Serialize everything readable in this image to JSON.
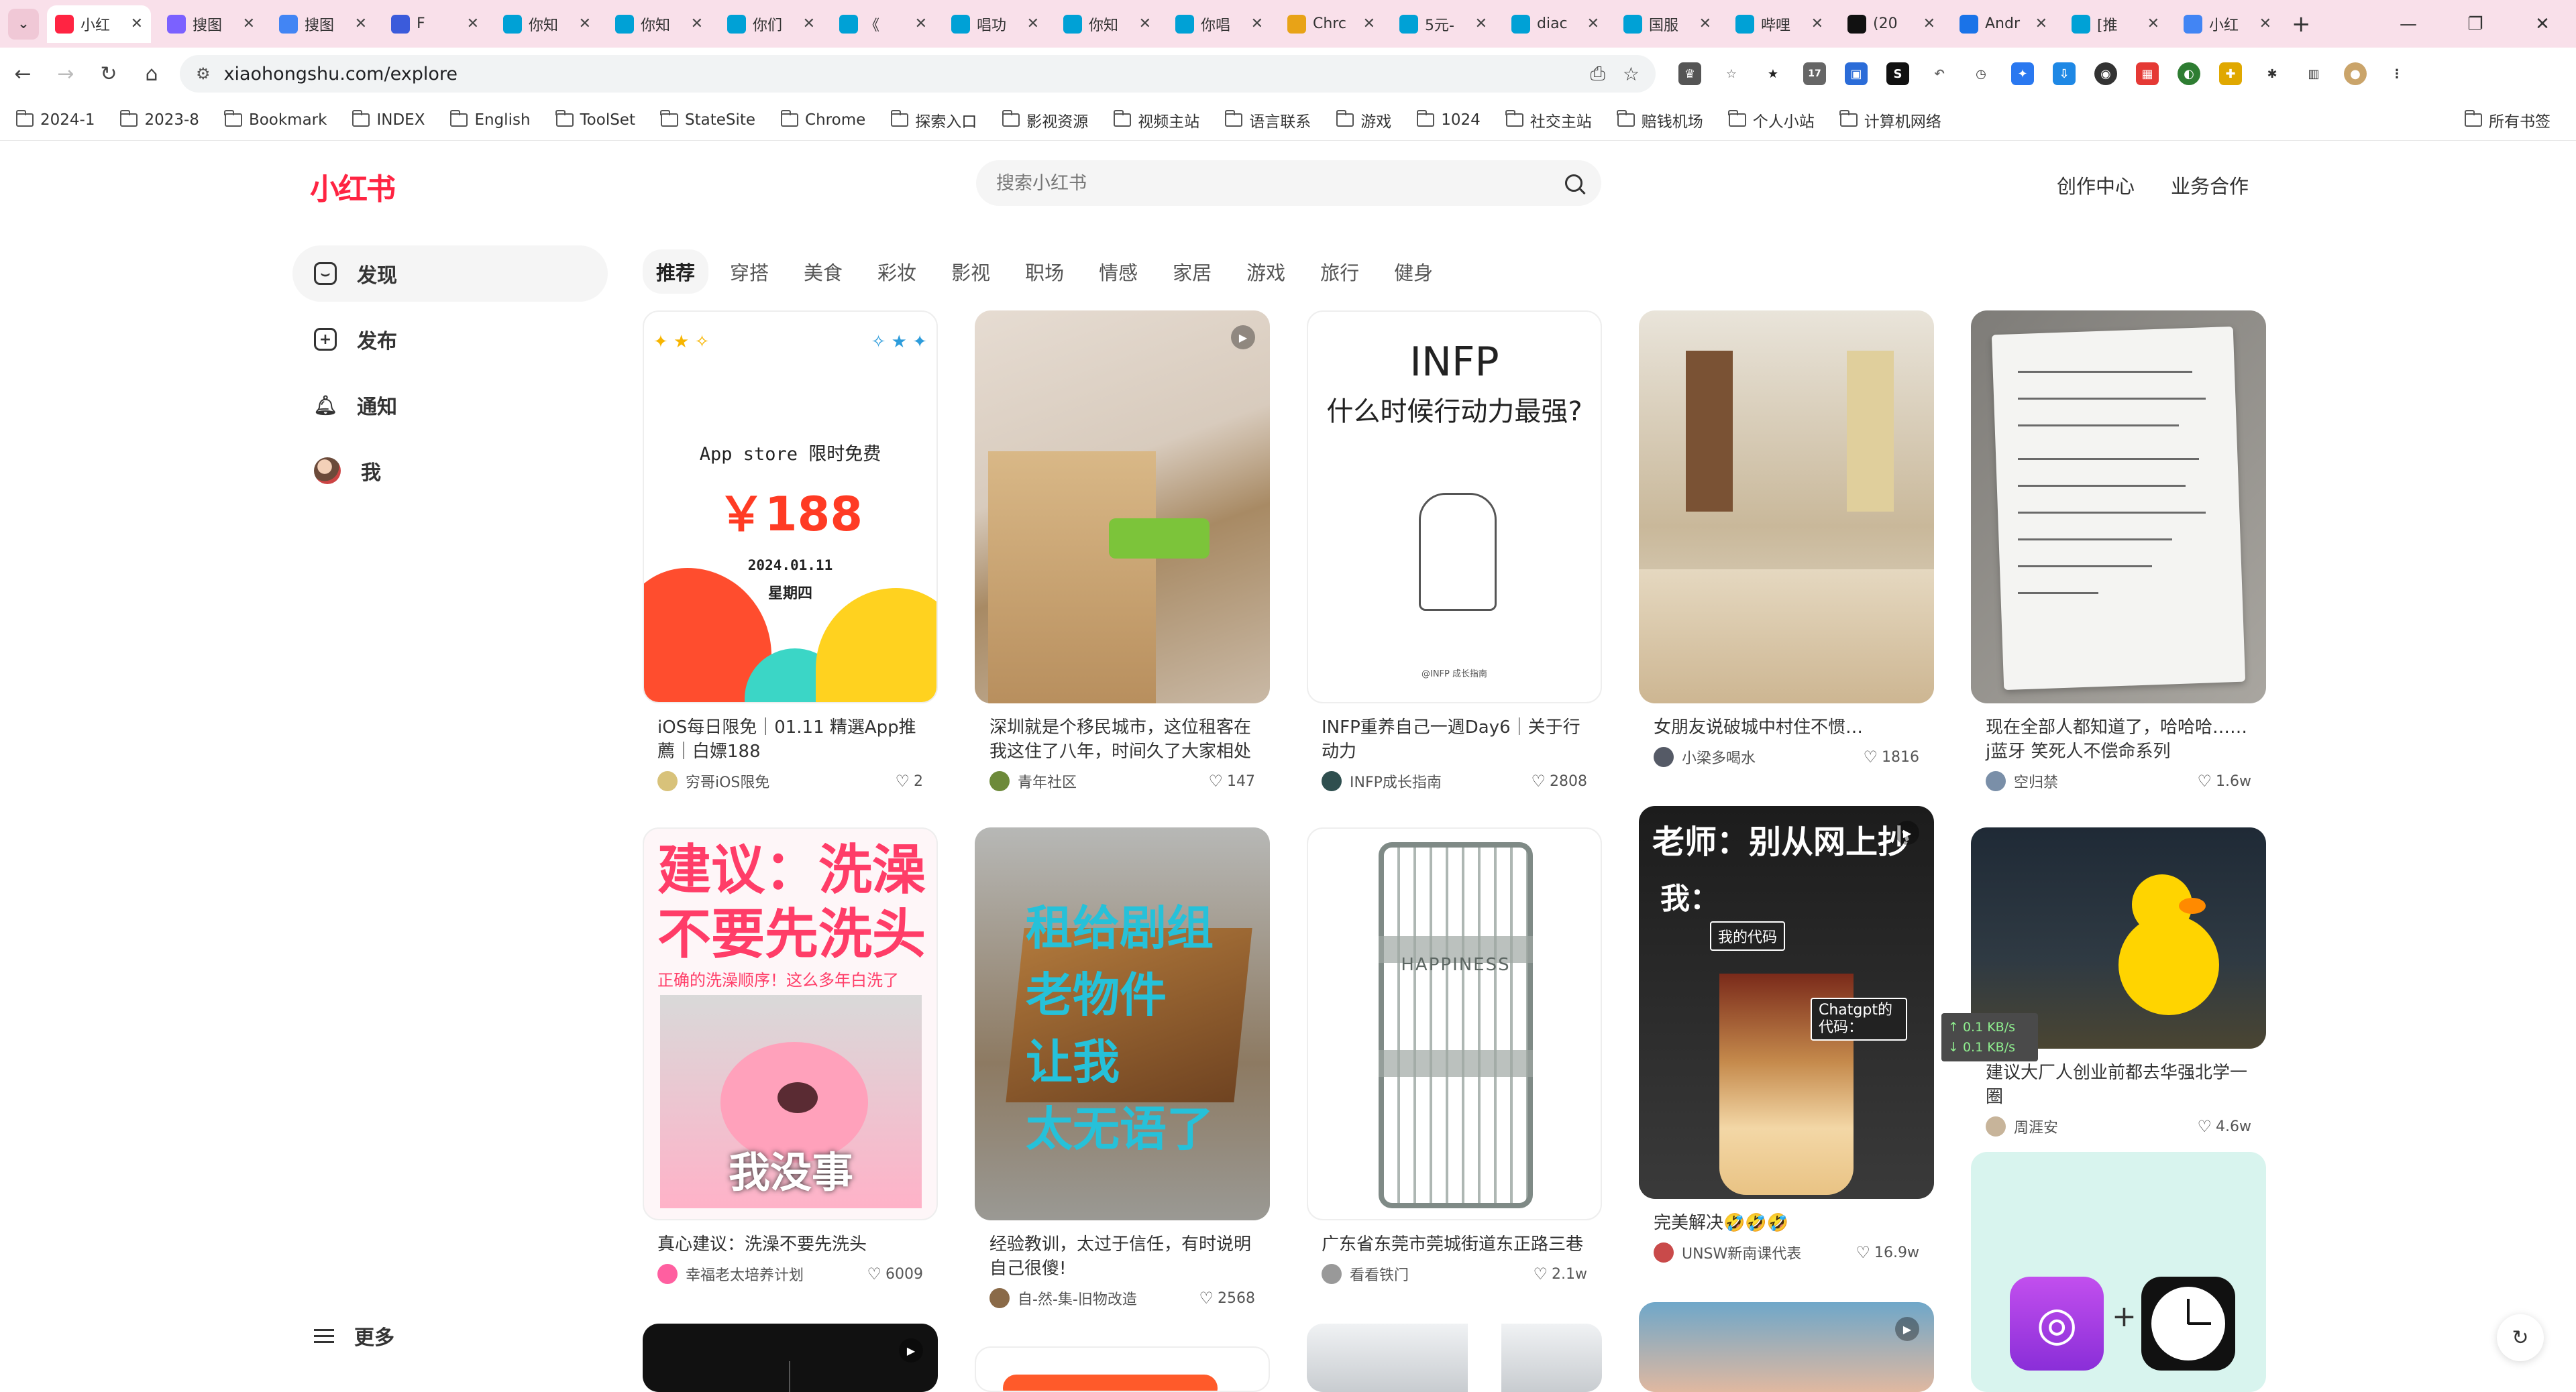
{
  "browser": {
    "tabs": [
      {
        "title": "小红",
        "favicon": "xhs",
        "active": true
      },
      {
        "title": "搜图",
        "favicon": "p"
      },
      {
        "title": "搜图",
        "favicon": "g"
      },
      {
        "title": "F",
        "favicon": "c"
      },
      {
        "title": "你知",
        "favicon": "bili"
      },
      {
        "title": "你知",
        "favicon": "bili"
      },
      {
        "title": "你们",
        "favicon": "bili"
      },
      {
        "title": "《",
        "favicon": "bili"
      },
      {
        "title": "唱功",
        "favicon": "bili"
      },
      {
        "title": "你知",
        "favicon": "bili"
      },
      {
        "title": "你唱",
        "favicon": "bili"
      },
      {
        "title": "Chrc",
        "favicon": "chrome"
      },
      {
        "title": "5元-",
        "favicon": "bili"
      },
      {
        "title": "diac",
        "favicon": "bili"
      },
      {
        "title": "国服",
        "favicon": "bili"
      },
      {
        "title": "哔哩",
        "favicon": "bili"
      },
      {
        "title": "(20",
        "favicon": "x"
      },
      {
        "title": "Andr",
        "favicon": "a"
      },
      {
        "title": "[推",
        "favicon": "bili"
      },
      {
        "title": "小红",
        "favicon": "g"
      }
    ],
    "url": "xiaohongshu.com/explore",
    "bookmarks": [
      "2024-1",
      "2023-8",
      "Bookmark",
      "INDEX",
      "English",
      "ToolSet",
      "StateSite",
      "Chrome",
      "探索入口",
      "影视资源",
      "视频主站",
      "语言联系",
      "游戏",
      "1024",
      "社交主站",
      "赔钱机场",
      "个人小站",
      "计算机网络"
    ],
    "all_bookmarks": "所有书签",
    "extension_badge": "17"
  },
  "page": {
    "logo": "小红书",
    "search_placeholder": "搜索小红书",
    "top_links": [
      "创作中心",
      "业务合作"
    ],
    "sidebar": [
      {
        "label": "发现",
        "icon": "home-icon",
        "active": true
      },
      {
        "label": "发布",
        "icon": "plus-square-icon"
      },
      {
        "label": "通知",
        "icon": "bell-icon"
      },
      {
        "label": "我",
        "icon": "avatar"
      }
    ],
    "more": "更多",
    "channels": [
      "推荐",
      "穿搭",
      "美食",
      "彩妆",
      "影视",
      "职场",
      "情感",
      "家居",
      "游戏",
      "旅行",
      "健身"
    ],
    "cards": [
      {
        "title": "iOS每日限免｜01.11 精選App推薦｜白嫖188",
        "author": "穷哥iOS限免",
        "likes": "2",
        "art": {
          "line1": "App store 限时免费",
          "price": "￥188",
          "date": "2024.01.11",
          "weekday": "星期四"
        }
      },
      {
        "title": "深圳就是个移民城市，这位租客在我这住了八年，时间久了大家相处的…",
        "author": "青年社区",
        "likes": "147",
        "video": true
      },
      {
        "title": "INFP重养自己一週Day6｜关于行动力",
        "author": "INFP成长指南",
        "likes": "2808",
        "art": {
          "heading": "INFP",
          "question": "什么时候行动力最强?",
          "caption": "@INFP 成长指南"
        }
      },
      {
        "title": "女朋友说破城中村住不惯…",
        "author": "小梁多喝水",
        "likes": "1816"
      },
      {
        "title": "现在全部人都知道了，哈哈哈……j蓝牙 笑死人不偿命系列",
        "author": "空归禁",
        "likes": "1.6w"
      },
      {
        "title": "真心建议：洗澡不要先洗头",
        "author": "幸福老太培养计划",
        "likes": "6009",
        "art": {
          "big1": "建议：洗澡",
          "big2": "不要先洗头",
          "sub": "正确的洗澡顺序！这么多年白洗了",
          "overlay": "我没事"
        }
      },
      {
        "title": "经验教训，太过于信任，有时说明自己很傻!",
        "author": "自-然-集-旧物改造",
        "likes": "2568",
        "art": {
          "lines": [
            "租给剧组",
            "老物件",
            "让我",
            "太无语了"
          ]
        }
      },
      {
        "title": "广东省东莞市莞城街道东正路三巷",
        "author": "看看铁门",
        "likes": "2.1w",
        "art": {
          "gate_text": "HAPPINESS"
        }
      },
      {
        "title": "完美解决🤣🤣🤣",
        "author": "UNSW新南课代表",
        "likes": "16.9w",
        "video": true,
        "art": {
          "heading": "老师：别从网上抄",
          "line2": "我：",
          "label1": "我的代码",
          "label2": "Chatgpt的代码："
        }
      },
      {
        "title": "建议大厂人创业前都去华强北学一圈",
        "author": "周涯安",
        "likes": "4.6w"
      }
    ]
  },
  "netspeed": {
    "up": "↑ 0.1 KB/s",
    "down": "↓ 0.1 KB/s"
  },
  "colors": {
    "brand": "#ff2442",
    "tabbar": "#f9e0ea"
  }
}
